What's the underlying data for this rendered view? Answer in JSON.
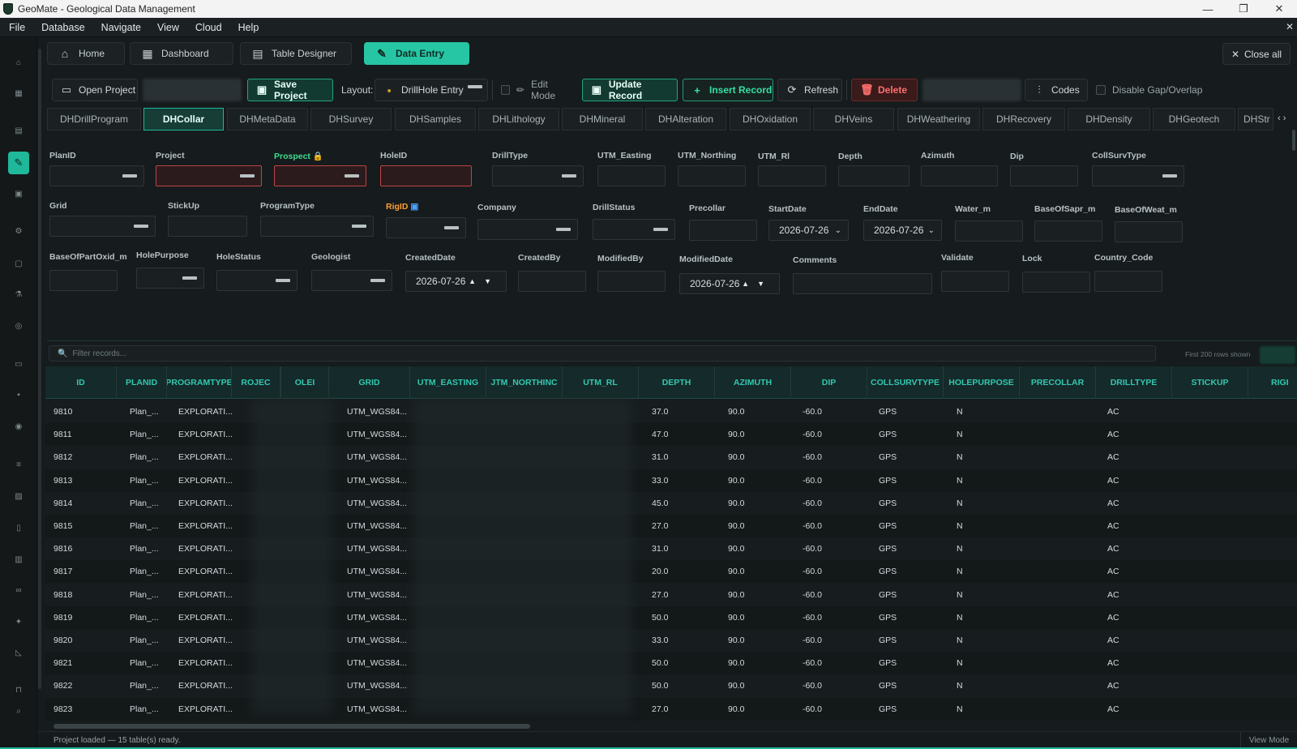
{
  "window": {
    "title": "GeoMate - Geological Data Management",
    "minimize": "—",
    "maximize": "❐",
    "close": "✕"
  },
  "menu": [
    "File",
    "Database",
    "Navigate",
    "View",
    "Cloud",
    "Help"
  ],
  "menu_close": "✕",
  "nav": {
    "home": "Home",
    "dashboard": "Dashboard",
    "table_designer": "Table Designer",
    "data_entry": "Data Entry",
    "close_all": "Close all"
  },
  "toolbar": {
    "open_project": "Open Project",
    "save_project": "Save Project",
    "layout_label": "Layout:",
    "layout_value": "DrillHole Entry",
    "edit_mode": "Edit Mode",
    "update_record": "Update Record",
    "insert_record": "Insert Record",
    "refresh": "Refresh",
    "delete": "Delete",
    "codes": "Codes",
    "disable_gap": "Disable Gap/Overlap"
  },
  "tables": [
    "DHDrillProgram",
    "DHCollar",
    "DHMetaData",
    "DHSurvey",
    "DHSamples",
    "DHLithology",
    "DHMineral",
    "DHAlteration",
    "DHOxidation",
    "DHVeins",
    "DHWeathering",
    "DHRecovery",
    "DHDensity",
    "DHGeotech",
    "DHStr"
  ],
  "active_table": "DHCollar",
  "form": {
    "PlanID": "PlanID",
    "Project": "Project",
    "Prospect": "Prospect",
    "HoleID": "HoleID",
    "DrillType": "DrillType",
    "UTM_Easting": "UTM_Easting",
    "UTM_Northing": "UTM_Northing",
    "UTM_Rl": "UTM_Rl",
    "Depth": "Depth",
    "Azimuth": "Azimuth",
    "Dip": "Dip",
    "CollSurvType": "CollSurvType",
    "Grid": "Grid",
    "StickUp": "StickUp",
    "ProgramType": "ProgramType",
    "RigID": "RigID",
    "Company": "Company",
    "DrillStatus": "DrillStatus",
    "Precollar": "Precollar",
    "StartDate": "StartDate",
    "EndDate": "EndDate",
    "Water_m": "Water_m",
    "BaseOfSapr_m": "BaseOfSapr_m",
    "BaseOfWeat_m": "BaseOfWeat_m",
    "BaseOfPartOxid_m": "BaseOfPartOxid_m",
    "HolePurpose": "HolePurpose",
    "HoleStatus": "HoleStatus",
    "Geologist": "Geologist",
    "CreatedDate": "CreatedDate",
    "CreatedBy": "CreatedBy",
    "ModifiedBy": "ModifiedBy",
    "ModifiedDate": "ModifiedDate",
    "Comments": "Comments",
    "Validate": "Validate",
    "Lock": "Lock",
    "Country_Code": "Country_Code",
    "start_date_value": "2026-07-26",
    "end_date_value": "2026-07-26",
    "created_date_value": "2026-07-26",
    "modified_date_value": "2026-07-26"
  },
  "grid": {
    "filter_placeholder": "Filter records...",
    "rows_note": "First 200 rows shown",
    "columns": [
      "ID",
      "PLANID",
      "PROGRAMTYPE",
      "ROJEC",
      "OLEI",
      "GRID",
      "UTM_EASTING",
      "JTM_NORTHINC",
      "UTM_RL",
      "DEPTH",
      "AZIMUTH",
      "DIP",
      "COLLSURVTYPE",
      "HOLEPURPOSE",
      "PRECOLLAR",
      "DRILLTYPE",
      "STICKUP",
      "RIGI"
    ],
    "rows": [
      [
        "9810",
        "Plan_...",
        "EXPLORATI...",
        "UTM_WGS84...",
        "37.0",
        "90.0",
        "-60.0",
        "GPS",
        "N",
        "AC"
      ],
      [
        "9811",
        "Plan_...",
        "EXPLORATI...",
        "UTM_WGS84...",
        "47.0",
        "90.0",
        "-60.0",
        "GPS",
        "N",
        "AC"
      ],
      [
        "9812",
        "Plan_...",
        "EXPLORATI...",
        "UTM_WGS84...",
        "31.0",
        "90.0",
        "-60.0",
        "GPS",
        "N",
        "AC"
      ],
      [
        "9813",
        "Plan_...",
        "EXPLORATI...",
        "UTM_WGS84...",
        "33.0",
        "90.0",
        "-60.0",
        "GPS",
        "N",
        "AC"
      ],
      [
        "9814",
        "Plan_...",
        "EXPLORATI...",
        "UTM_WGS84...",
        "45.0",
        "90.0",
        "-60.0",
        "GPS",
        "N",
        "AC"
      ],
      [
        "9815",
        "Plan_...",
        "EXPLORATI...",
        "UTM_WGS84...",
        "27.0",
        "90.0",
        "-60.0",
        "GPS",
        "N",
        "AC"
      ],
      [
        "9816",
        "Plan_...",
        "EXPLORATI...",
        "UTM_WGS84...",
        "31.0",
        "90.0",
        "-60.0",
        "GPS",
        "N",
        "AC"
      ],
      [
        "9817",
        "Plan_...",
        "EXPLORATI...",
        "UTM_WGS84...",
        "20.0",
        "90.0",
        "-60.0",
        "GPS",
        "N",
        "AC"
      ],
      [
        "9818",
        "Plan_...",
        "EXPLORATI...",
        "UTM_WGS84...",
        "27.0",
        "90.0",
        "-60.0",
        "GPS",
        "N",
        "AC"
      ],
      [
        "9819",
        "Plan_...",
        "EXPLORATI...",
        "UTM_WGS84...",
        "50.0",
        "90.0",
        "-60.0",
        "GPS",
        "N",
        "AC"
      ],
      [
        "9820",
        "Plan_...",
        "EXPLORATI...",
        "UTM_WGS84...",
        "33.0",
        "90.0",
        "-60.0",
        "GPS",
        "N",
        "AC"
      ],
      [
        "9821",
        "Plan_...",
        "EXPLORATI...",
        "UTM_WGS84...",
        "50.0",
        "90.0",
        "-60.0",
        "GPS",
        "N",
        "AC"
      ],
      [
        "9822",
        "Plan_...",
        "EXPLORATI...",
        "UTM_WGS84...",
        "50.0",
        "90.0",
        "-60.0",
        "GPS",
        "N",
        "AC"
      ],
      [
        "9823",
        "Plan_...",
        "EXPLORATI...",
        "UTM_WGS84...",
        "27.0",
        "90.0",
        "-60.0",
        "GPS",
        "N",
        "AC"
      ]
    ]
  },
  "status": {
    "left": "Project loaded — 15 table(s) ready.",
    "right": "View Mode"
  },
  "colors": {
    "accent": "#26c6a4",
    "error_border": "#c04444",
    "header_text": "#32c8b0"
  }
}
